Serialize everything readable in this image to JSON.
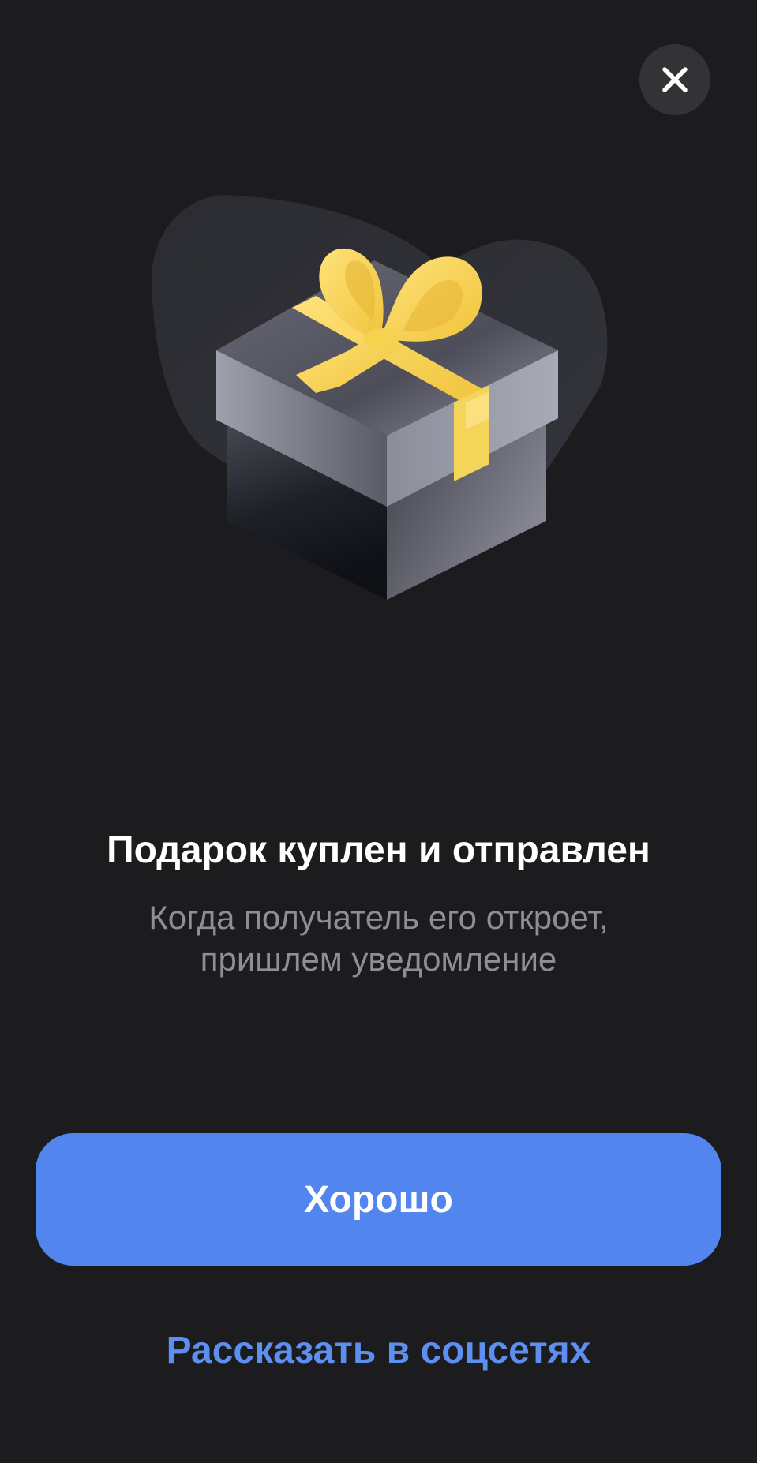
{
  "dialog": {
    "title": "Подарок куплен и отправлен",
    "subtitle_lines": [
      "Когда получатель его откроет,",
      "пришлем уведомление"
    ],
    "illustration_icon": "gift-box-icon",
    "close_icon": "close-icon"
  },
  "actions": {
    "primary_label": "Хорошо",
    "share_label": "Рассказать в соцсетях"
  },
  "colors": {
    "background": "#1c1c1e",
    "accent": "#5286ee",
    "link": "#5c8ff0",
    "ribbon": "#f5cf4a",
    "secondary_text": "#8e8e93"
  }
}
